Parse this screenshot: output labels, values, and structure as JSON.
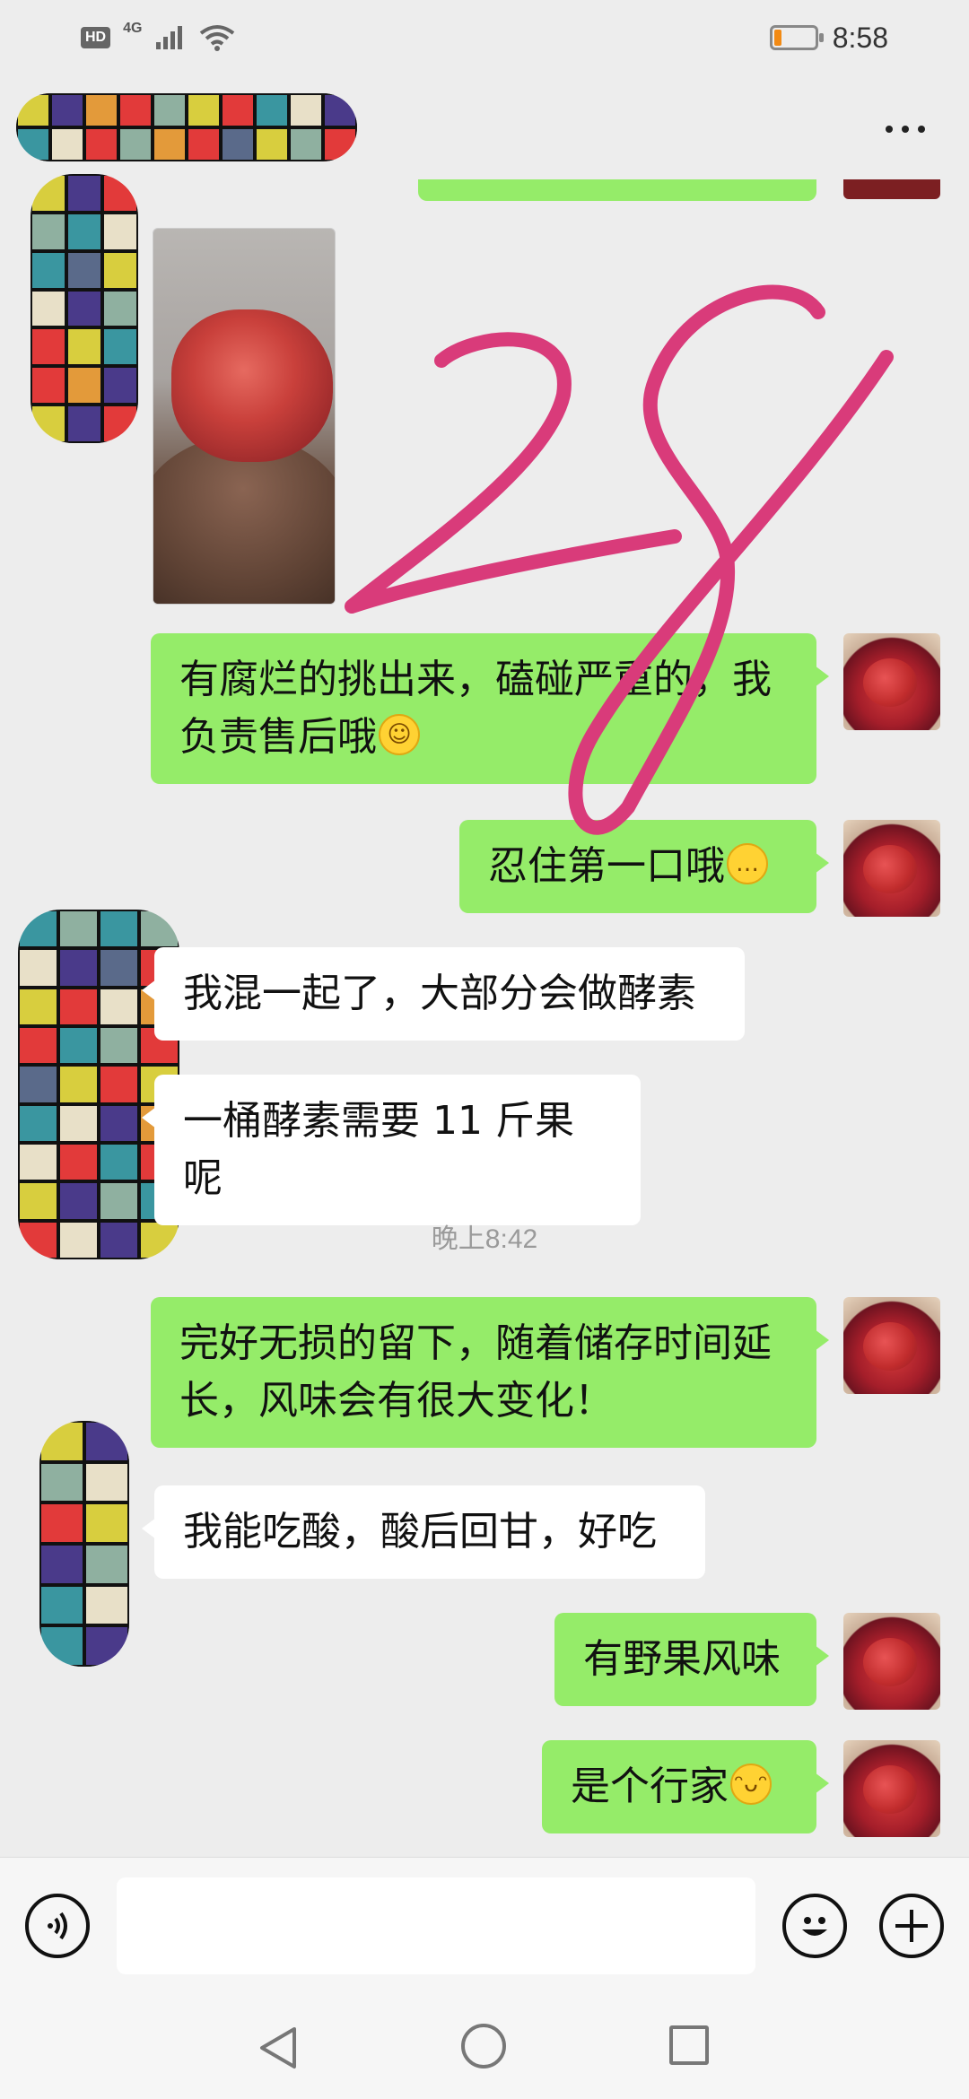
{
  "status_bar": {
    "network_badge": "HD",
    "network_type": "4G",
    "time": "8:58",
    "battery_level": 0.18,
    "battery_color": "#f28a14"
  },
  "header": {
    "more_icon": "more-dots-icon"
  },
  "messages": [
    {
      "id": "m1",
      "side": "right",
      "text": "有腐烂的挑出来，磕碰严重的，我负责售后哦",
      "emoji": "smile"
    },
    {
      "id": "m2",
      "side": "right",
      "text": "忍住第一口哦",
      "emoji": "thinking"
    },
    {
      "id": "m3",
      "side": "left",
      "text": "我混一起了，大部分会做酵素"
    },
    {
      "id": "m4",
      "side": "left",
      "text": "一桶酵素需要 11 斤果呢"
    },
    {
      "id": "m5",
      "side": "right",
      "text": "完好无损的留下，随着储存时间延长，风味会有很大变化！"
    },
    {
      "id": "m6",
      "side": "left",
      "text": "我能吃酸，酸后回甘，好吃"
    },
    {
      "id": "m7",
      "side": "right",
      "text": "有野果风味"
    },
    {
      "id": "m8",
      "side": "right",
      "text": "是个行家",
      "emoji": "grin"
    }
  ],
  "timestamp": "晚上8:42",
  "handwriting": "28",
  "colors": {
    "bubble_green": "#95ec69",
    "bubble_white": "#ffffff",
    "background": "#ededed",
    "scribble": "#d93b7a"
  },
  "input_bar": {
    "voice_icon": "voice-icon",
    "emoji_icon": "emoji-icon",
    "plus_icon": "plus-icon",
    "text_value": ""
  },
  "nav_bar": {
    "back_icon": "back-triangle-icon",
    "home_icon": "home-circle-icon",
    "recent_icon": "recent-square-icon"
  }
}
